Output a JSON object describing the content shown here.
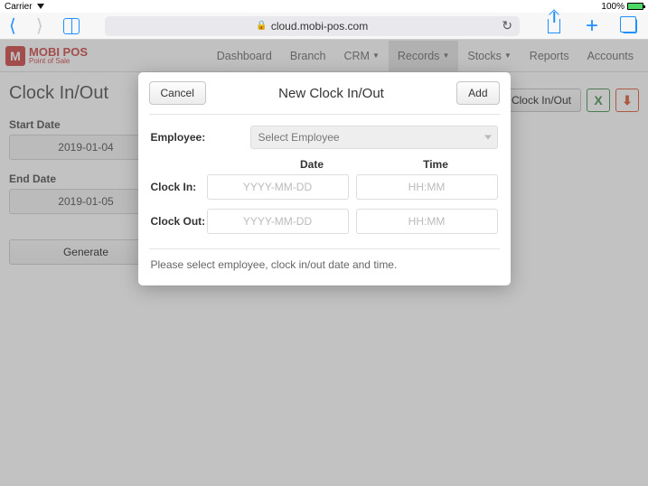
{
  "status": {
    "carrier": "Carrier",
    "battery_pct": "100%"
  },
  "browser": {
    "url": "cloud.mobi-pos.com"
  },
  "logo": {
    "letter": "M",
    "brand": "MOBI POS",
    "tagline": "Point of Sale"
  },
  "nav": {
    "dashboard": "Dashboard",
    "branch": "Branch",
    "crm": "CRM",
    "records": "Records",
    "stocks": "Stocks",
    "reports": "Reports",
    "accounts": "Accounts"
  },
  "page": {
    "title": "Clock In/Out",
    "start_label": "Start Date",
    "start_value": "2019-01-04",
    "end_label": "End Date",
    "end_value": "2019-01-05",
    "generate": "Generate",
    "new_btn": "New Clock In/Out",
    "export_xls": "X",
    "export_pdf": "⎙"
  },
  "modal": {
    "cancel": "Cancel",
    "title": "New Clock In/Out",
    "add": "Add",
    "employee_label": "Employee:",
    "employee_placeholder": "Select Employee",
    "date_hdr": "Date",
    "time_hdr": "Time",
    "clock_in_label": "Clock In:",
    "clock_out_label": "Clock Out:",
    "date_ph": "YYYY-MM-DD",
    "time_ph": "HH:MM",
    "footer": "Please select employee, clock in/out date and time."
  }
}
